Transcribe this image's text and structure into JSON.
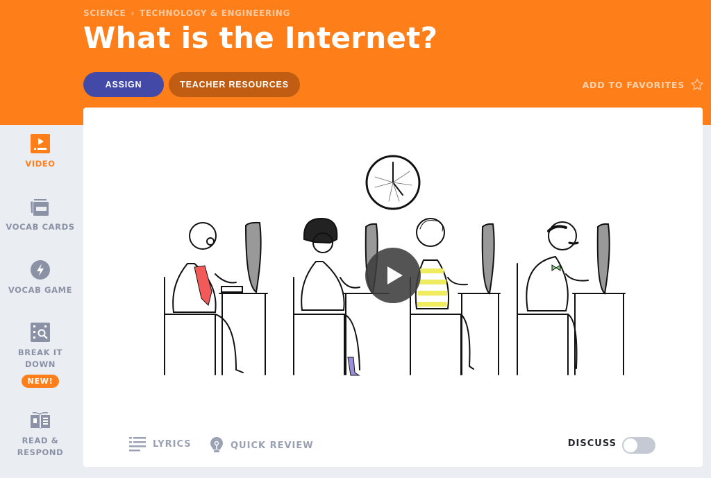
{
  "header": {
    "breadcrumb": [
      "Science",
      "Technology & Engineering"
    ],
    "breadcrumb_separator": "›",
    "title": "What is the Internet?",
    "assign_label": "Assign",
    "teacher_resources_label": "Teacher Resources",
    "favorites_label": "Add to Favorites",
    "colors": {
      "header_bg": "#fe7f19",
      "assign_bg": "#4249a6",
      "teacher_bg": "#c15d12"
    }
  },
  "sidebar": {
    "items": [
      {
        "label": "Video",
        "icon": "video-icon",
        "active": true
      },
      {
        "label": "Vocab Cards",
        "icon": "vocab-cards-icon",
        "active": false
      },
      {
        "label": "Vocab Game",
        "icon": "lightning-icon",
        "active": false
      },
      {
        "label": "Break It Down",
        "icon": "magnifier-grid-icon",
        "active": false,
        "badge": "NEW!"
      },
      {
        "label": "Read & Respond",
        "icon": "open-book-icon",
        "active": false
      }
    ]
  },
  "video": {
    "thumbnail": "four cartoon people typing at computers beneath a cobwebbed clock",
    "play_icon": "play-icon"
  },
  "toolbar": {
    "lyrics_label": "Lyrics",
    "quick_review_label": "Quick Review",
    "discuss_label": "Discuss",
    "discuss_on": false
  }
}
